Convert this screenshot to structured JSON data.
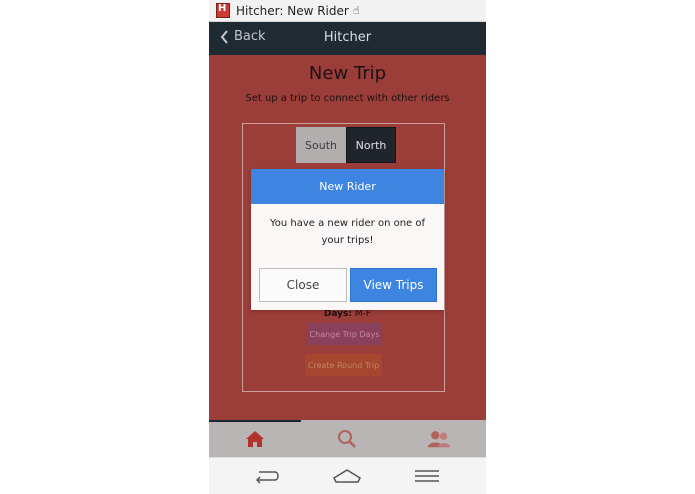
{
  "status_bar": {
    "notification_text": "Hitcher: New Rider"
  },
  "nav": {
    "back_label": "Back",
    "title": "Hitcher"
  },
  "page": {
    "title": "New Trip",
    "subtitle": "Set up a trip to connect with other riders",
    "direction": {
      "options": [
        "South",
        "North"
      ],
      "selected": "North"
    },
    "days_label": "Days:",
    "days_value": "M-F",
    "change_days_label": "Change Trip Days",
    "round_trip_label": "Create Round Trip"
  },
  "modal": {
    "title": "New Rider",
    "message": "You have a new rider on one of your trips!",
    "close_label": "Close",
    "view_label": "View Trips"
  },
  "tabs": [
    {
      "icon": "home-icon",
      "active": true
    },
    {
      "icon": "search-icon",
      "active": false
    },
    {
      "icon": "riders-icon",
      "active": false
    }
  ],
  "colors": {
    "background_red": "#9e3a35",
    "nav_dark": "#1b2630",
    "primary_blue": "#3d85e0",
    "tab_active": "#b2322e"
  }
}
